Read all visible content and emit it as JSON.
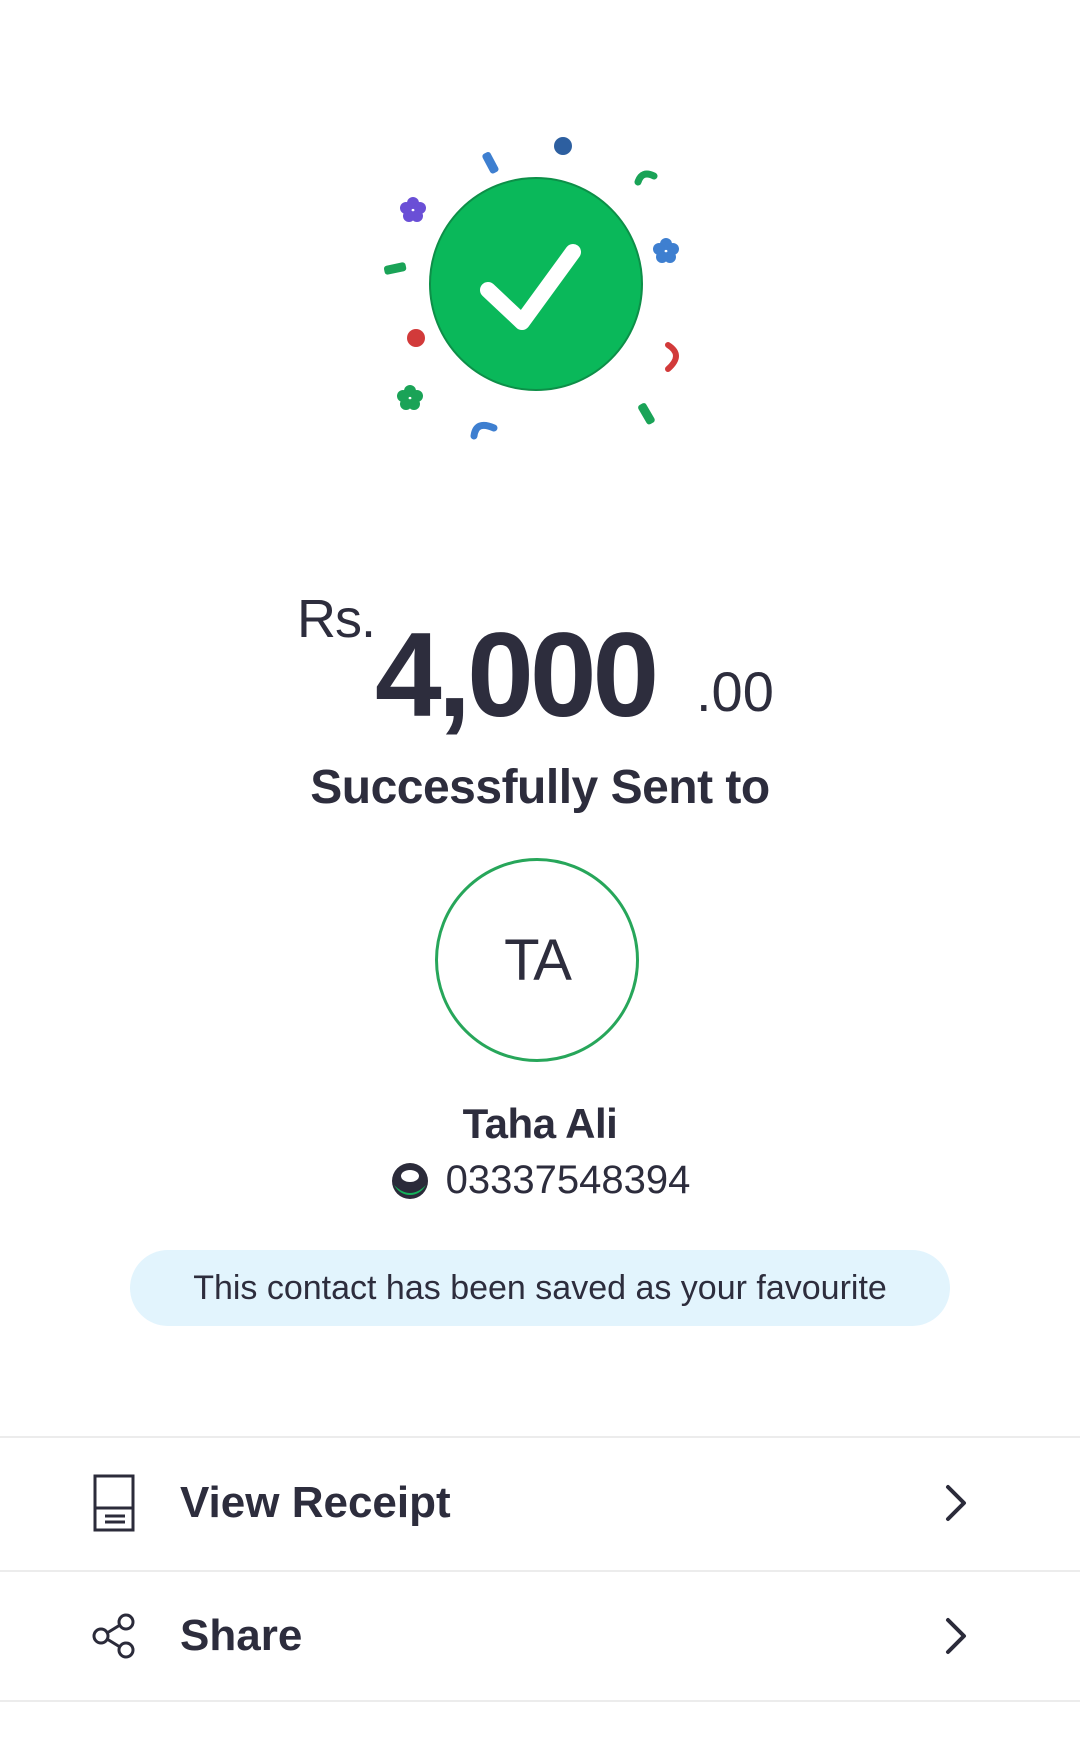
{
  "transaction": {
    "currency": "Rs.",
    "amount_whole": "4,000",
    "amount_decimal": ".00",
    "status_text": "Successfully Sent to"
  },
  "recipient": {
    "initials": "TA",
    "name": "Taha Ali",
    "phone": "03337548394"
  },
  "favourite_notice": "This contact has been saved as your favourite",
  "actions": [
    {
      "label": "View Receipt",
      "icon": "receipt-icon"
    },
    {
      "label": "Share",
      "icon": "share-icon"
    }
  ],
  "colors": {
    "success_green": "#0ab85a",
    "avatar_ring": "#27a65a",
    "banner_bg": "#e2f4fd",
    "text_dark": "#2d2d3d"
  }
}
